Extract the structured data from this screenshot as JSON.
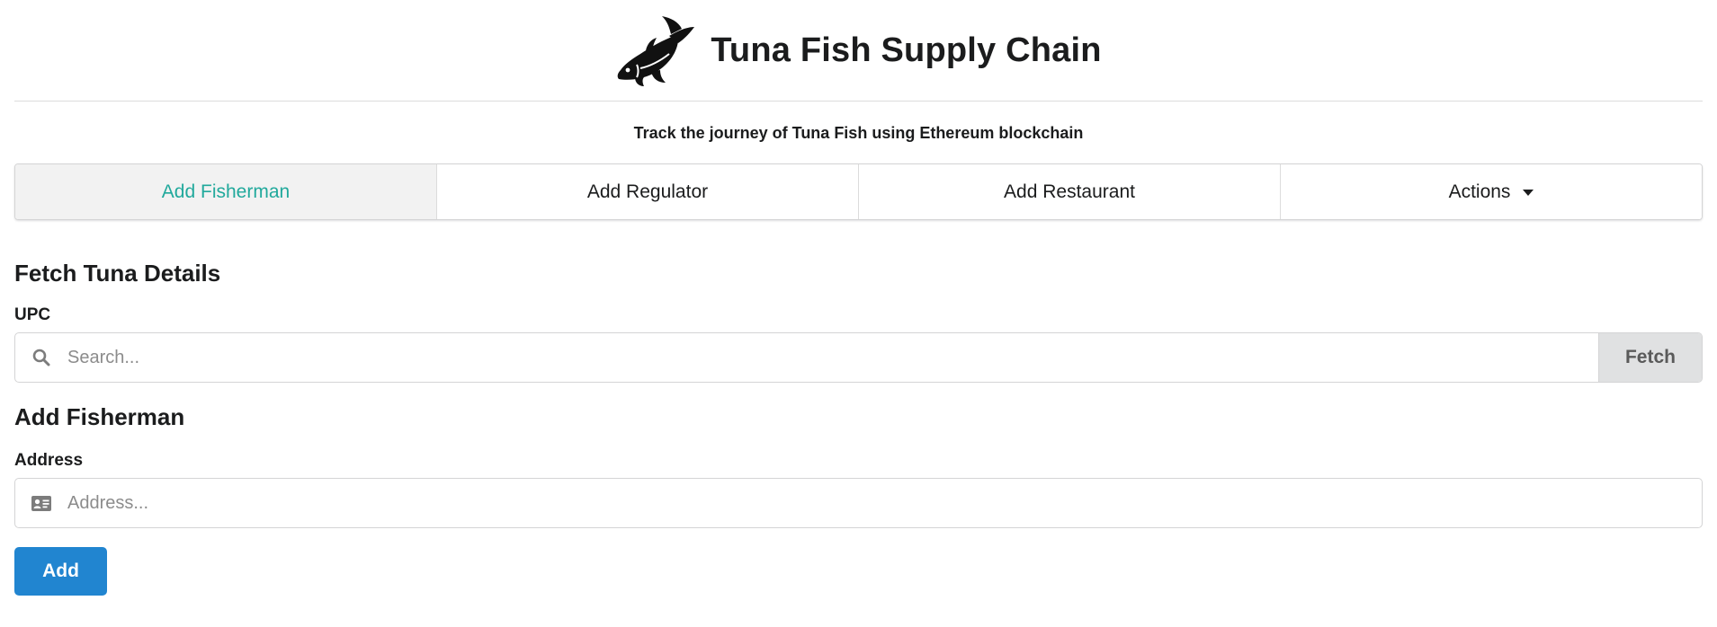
{
  "header": {
    "title": "Tuna Fish Supply Chain",
    "logo_icon": "tuna-fish-icon",
    "subtitle": "Track the journey of Tuna Fish using Ethereum blockchain"
  },
  "tabs": [
    {
      "label": "Add Fisherman",
      "active": true
    },
    {
      "label": "Add Regulator",
      "active": false
    },
    {
      "label": "Add Restaurant",
      "active": false
    },
    {
      "label": "Actions",
      "active": false,
      "icon": "caret-down-icon"
    }
  ],
  "fetch_section": {
    "title": "Fetch Tuna Details",
    "field_label": "UPC",
    "input_icon": "search-icon",
    "placeholder": "Search...",
    "value": "",
    "button_label": "Fetch"
  },
  "fisherman_section": {
    "title": "Add Fisherman",
    "field_label": "Address",
    "input_icon": "id-card-icon",
    "placeholder": "Address...",
    "value": "",
    "button_label": "Add"
  },
  "colors": {
    "active_tab_text": "#21a99c",
    "active_tab_bg": "#f2f2f2",
    "primary_button": "#2185d0",
    "fetch_button_bg": "#e0e1e2"
  }
}
